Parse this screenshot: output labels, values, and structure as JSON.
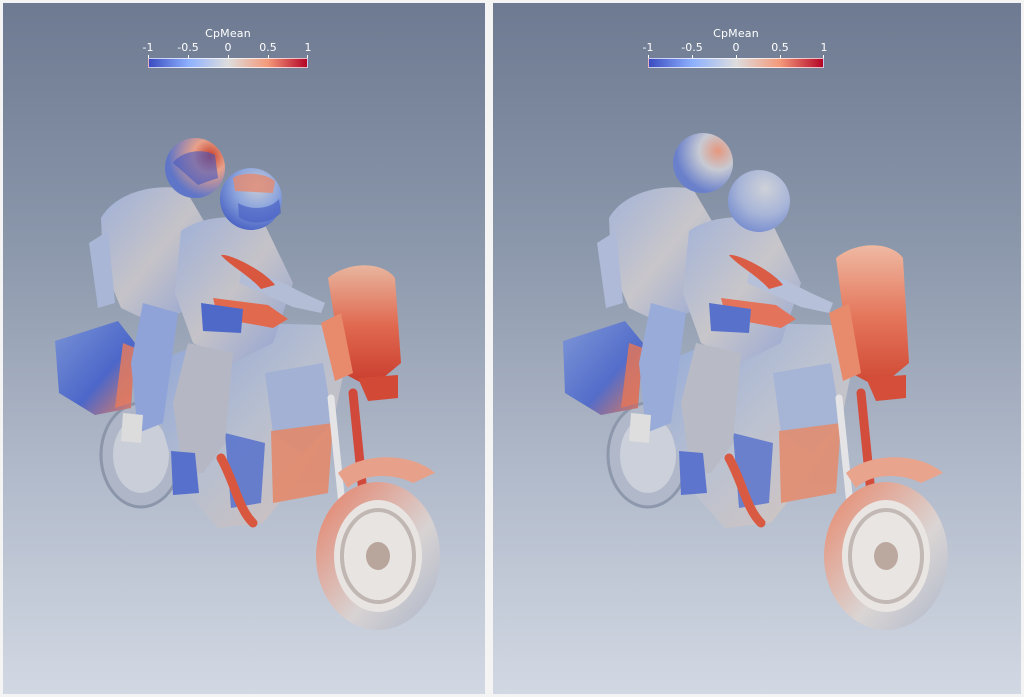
{
  "panels": [
    {
      "id": "left",
      "colorbar": {
        "title": "CpMean",
        "ticks": [
          "-1",
          "-0.5",
          "0",
          "0.5",
          "1"
        ],
        "colors": [
          "#3b4cc0",
          "#8db0fe",
          "#dddddd",
          "#f49a7b",
          "#b40426"
        ]
      }
    },
    {
      "id": "right",
      "colorbar": {
        "title": "CpMean",
        "ticks": [
          "-1",
          "-0.5",
          "0",
          "0.5",
          "1"
        ],
        "colors": [
          "#3b4cc0",
          "#8db0fe",
          "#dddddd",
          "#f49a7b",
          "#b40426"
        ]
      }
    }
  ]
}
